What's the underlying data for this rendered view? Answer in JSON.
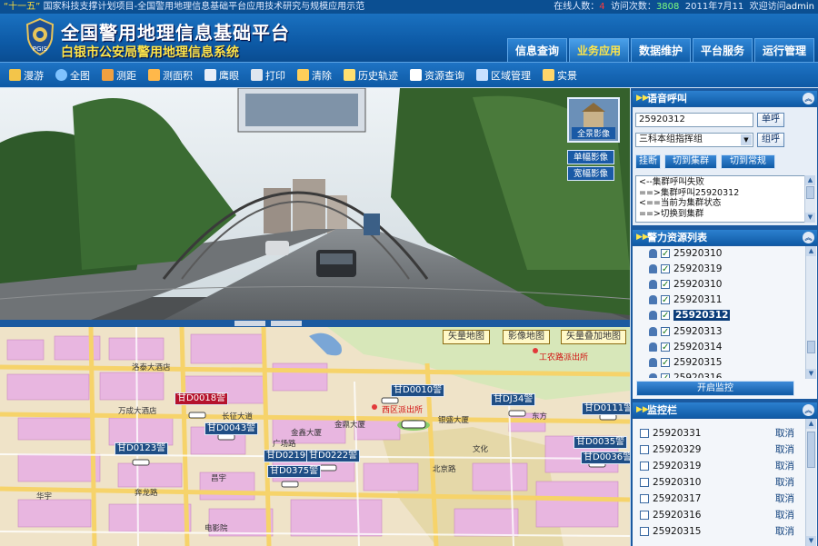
{
  "topbar": {
    "project_prefix": "“十一五”",
    "project_text": "国家科技支撑计划项目-全国警用地理信息基础平台应用技术研究与规模应用示范",
    "online_label": "在线人数：",
    "online_count": "4",
    "visits_label": "访问次数：",
    "visits_count": "3808",
    "date": "2011年7月11",
    "welcome": "欢迎访问",
    "user": "admin"
  },
  "header": {
    "title": "全国警用地理信息基础平台",
    "subtitle": "白银市公安局警用地理信息系统",
    "logo_text": "PGIS"
  },
  "mainnav": {
    "items": [
      "信息查询",
      "业务应用",
      "数据维护",
      "平台服务",
      "运行管理"
    ],
    "active_index": 1
  },
  "toolbar": {
    "items": [
      {
        "label": "漫游",
        "icon": "hand-icon",
        "color": "#f3c54a"
      },
      {
        "label": "全图",
        "icon": "globe-icon",
        "color": "#7fc3ff"
      },
      {
        "label": "测距",
        "icon": "ruler-icon",
        "color": "#f0a040"
      },
      {
        "label": "测面积",
        "icon": "area-icon",
        "color": "#ffb84a"
      },
      {
        "label": "鹰眼",
        "icon": "eagle-eye-icon",
        "color": "#e8eef8"
      },
      {
        "label": "打印",
        "icon": "printer-icon",
        "color": "#dfe6ef"
      },
      {
        "label": "清除",
        "icon": "eraser-icon",
        "color": "#ffcf5a"
      },
      {
        "label": "历史轨迹",
        "icon": "history-track-icon",
        "color": "#ffe070"
      },
      {
        "label": "资源查询",
        "icon": "resource-search-icon",
        "color": "#ffffff"
      },
      {
        "label": "区域管理",
        "icon": "region-manage-icon",
        "color": "#c8e0ff"
      },
      {
        "label": "实景",
        "icon": "street-view-icon",
        "color": "#ffd66a"
      }
    ]
  },
  "photo": {
    "thumb_main": "全景影像",
    "thumb_single": "单幅影像",
    "thumb_wide": "宽幅影像"
  },
  "map": {
    "buttons": [
      "矢量地图",
      "影像地图",
      "矢量叠加地图"
    ],
    "pois": [
      "工农路派出所",
      "西区派出所"
    ],
    "places": [
      "洛泰大酒店",
      "万成大酒店",
      "长征大道",
      "金鑫大厦",
      "金鼎大厦",
      "银盛大厦",
      "东方",
      "昌宇",
      "华宇",
      "奔龙路",
      "北京路",
      "广场路",
      "文化",
      "电影院"
    ],
    "vehicles": [
      {
        "label": "甘D0018警",
        "selected": true
      },
      {
        "label": "甘D0043警",
        "selected": false
      },
      {
        "label": "甘D0010警",
        "selected": false
      },
      {
        "label": "甘DJ34警",
        "selected": false
      },
      {
        "label": "甘D0111警",
        "selected": false
      },
      {
        "label": "甘D0123警",
        "selected": false
      },
      {
        "label": "甘D0219警",
        "selected": false
      },
      {
        "label": "甘D0222警",
        "selected": false
      },
      {
        "label": "甘D0375警",
        "selected": false
      },
      {
        "label": "甘D0035警",
        "selected": false
      },
      {
        "label": "甘D0036警",
        "selected": false
      }
    ]
  },
  "voice_call": {
    "title": "语音呼叫",
    "number_value": "25920312",
    "call_button": "单呼",
    "group_select": "三科本组指挥组",
    "group_call_button": "组呼",
    "hangup_button": "挂断",
    "switch_group_button": "切到集群",
    "switch_normal_button": "切到常规",
    "log": [
      "<--集群呼叫失败",
      "==>集群呼叫25920312",
      "<==当前为集群状态",
      "==>切换到集群"
    ]
  },
  "police_resources": {
    "title": "警力资源列表",
    "items": [
      "25920310",
      "25920319",
      "25920310",
      "25920311",
      "25920312",
      "25920313",
      "25920314",
      "25920315",
      "25920316"
    ],
    "selected_index": 4,
    "monitor_button": "开启监控"
  },
  "monitor": {
    "title": "监控栏",
    "items": [
      "25920331",
      "25920329",
      "25920319",
      "25920310",
      "25920317",
      "25920316",
      "25920315"
    ],
    "cancel_label": "取消"
  }
}
